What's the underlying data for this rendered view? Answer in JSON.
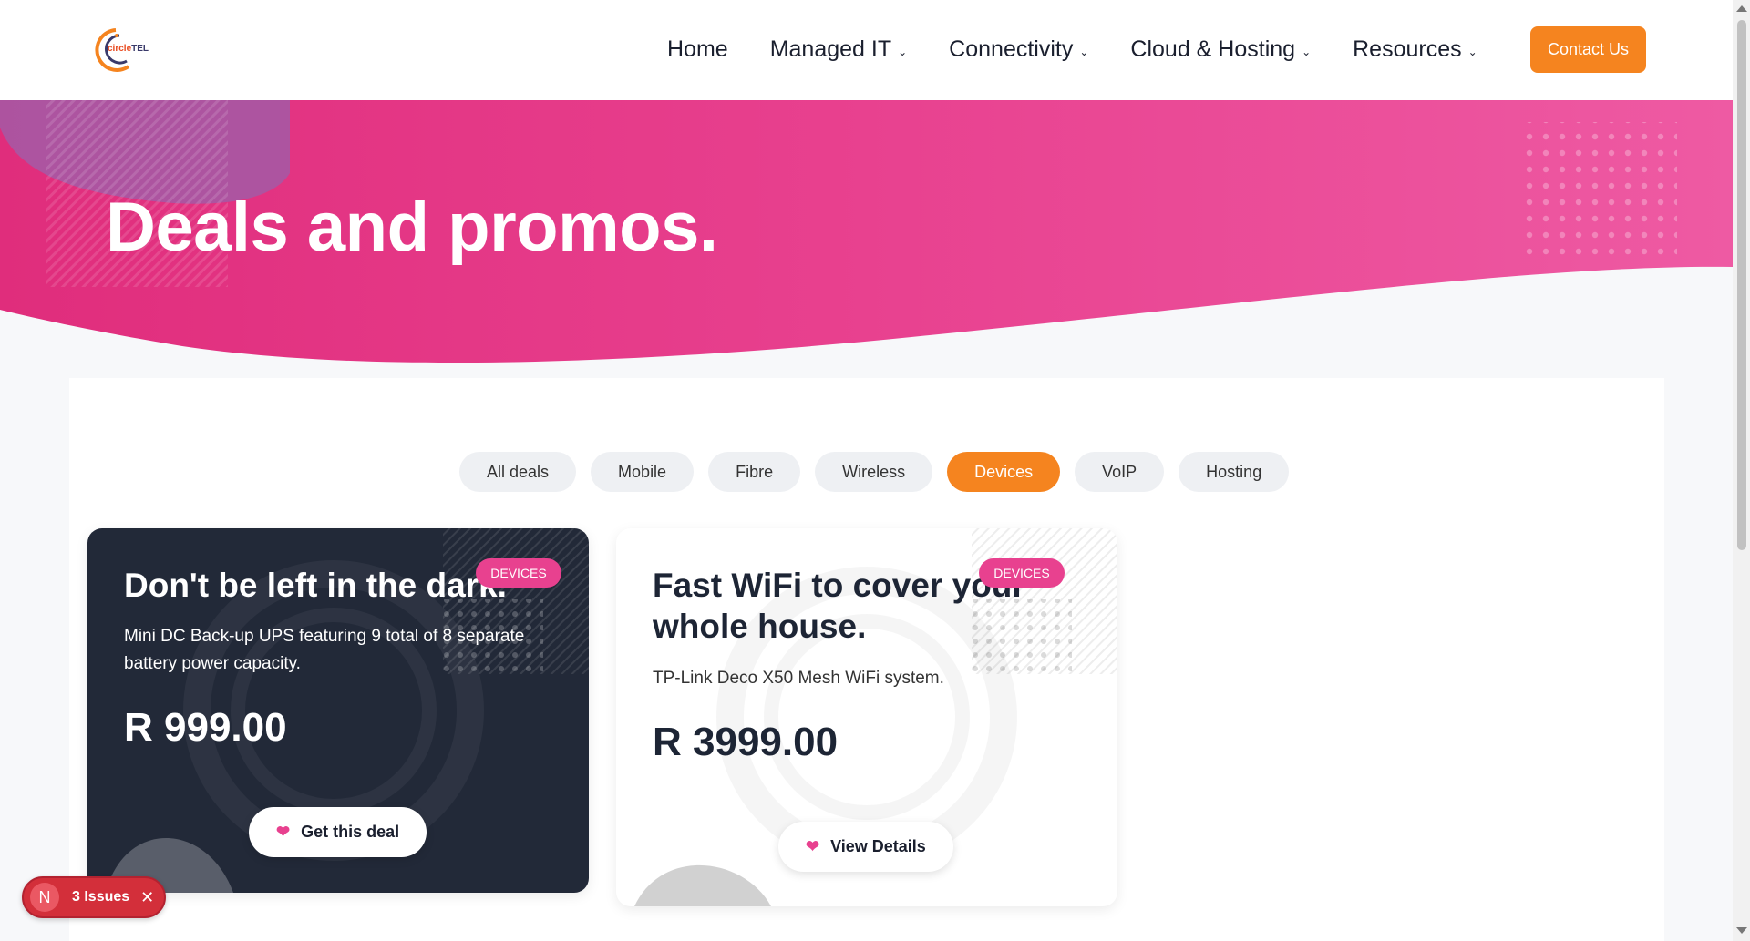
{
  "header": {
    "logo_text_a": "circle",
    "logo_text_b": "TEL",
    "nav": [
      {
        "label": "Home",
        "has_dropdown": false
      },
      {
        "label": "Managed IT",
        "has_dropdown": true
      },
      {
        "label": "Connectivity",
        "has_dropdown": true
      },
      {
        "label": "Cloud & Hosting",
        "has_dropdown": true
      },
      {
        "label": "Resources",
        "has_dropdown": true
      }
    ],
    "contact_label": "Contact Us"
  },
  "hero": {
    "title": "Deals and promos."
  },
  "filters": {
    "items": [
      "All deals",
      "Mobile",
      "Fibre",
      "Wireless",
      "Devices",
      "VoIP",
      "Hosting"
    ],
    "active": "Devices"
  },
  "deals": [
    {
      "badge": "DEVICES",
      "title": "Don't be left in the dark.",
      "description": "Mini DC Back-up UPS featuring 9 total of 8 separate battery power capacity.",
      "price": "R 999.00",
      "button": "Get this deal",
      "theme": "dark"
    },
    {
      "badge": "DEVICES",
      "title": "Fast WiFi to cover your whole house.",
      "description": "TP-Link Deco X50 Mesh WiFi system.",
      "price": "R 3999.00",
      "button": "View Details",
      "theme": "light"
    }
  ],
  "dev_overlay": {
    "icon_letter": "N",
    "label": "3 Issues"
  },
  "colors": {
    "accent_orange": "#f5841f",
    "hero_pink": "#e8418f",
    "dark_card": "#222938"
  },
  "icons": {
    "chevron": "chevron-down-icon",
    "heart": "heart-icon",
    "close": "close-icon"
  }
}
